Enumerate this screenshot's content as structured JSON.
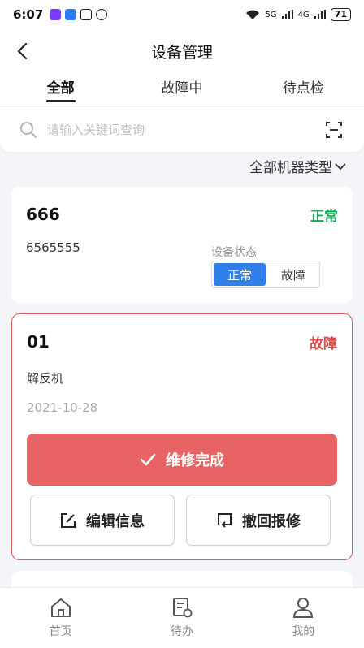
{
  "status_bar": {
    "time": "6:07",
    "battery": "71",
    "signal1": "5G",
    "signal2": "4G"
  },
  "header": {
    "title": "设备管理"
  },
  "tabs": [
    {
      "label": "全部"
    },
    {
      "label": "故障中"
    },
    {
      "label": "待点检"
    }
  ],
  "search": {
    "placeholder": "请输入关键词查询"
  },
  "filter": {
    "label": "全部机器类型"
  },
  "cards": [
    {
      "title": "666",
      "status": "正常",
      "desc": "6565555",
      "state_label": "设备状态",
      "state_options": [
        "正常",
        "故障"
      ]
    },
    {
      "title": "01",
      "status": "故障",
      "desc": "解反机",
      "date": "2021-10-28",
      "repair_label": "维修完成",
      "edit_label": "编辑信息",
      "revoke_label": "撤回报修"
    }
  ],
  "bottom_nav": [
    {
      "label": "首页"
    },
    {
      "label": "待办"
    },
    {
      "label": "我的"
    }
  ],
  "colors": {
    "ok": "#19a85b",
    "fault": "#e04a4a",
    "repair_button": "#e86464",
    "selected": "#2f7fe8"
  }
}
